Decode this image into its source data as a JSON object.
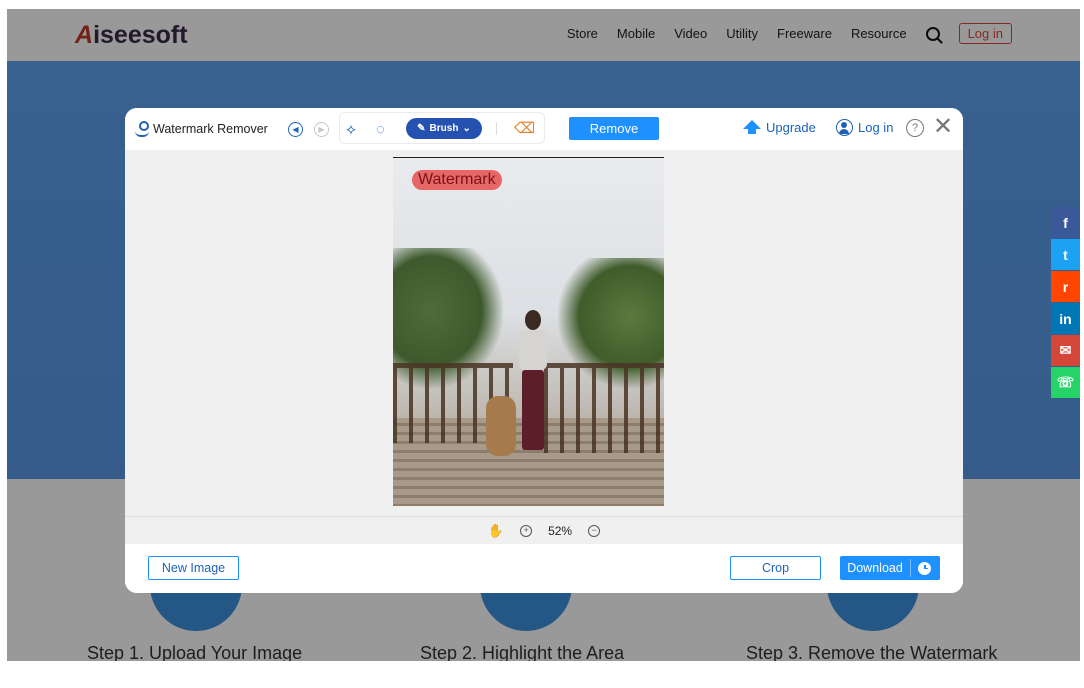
{
  "site": {
    "logo_mark": "A",
    "logo_text": "iseesoft",
    "nav": [
      "Store",
      "Mobile",
      "Video",
      "Utility",
      "Freeware",
      "Resource"
    ],
    "login_label": "Log in",
    "steps": [
      "Step 1. Upload Your Image",
      "Step 2. Highlight the Area",
      "Step 3. Remove the Watermark"
    ]
  },
  "social": [
    {
      "icon": "facebook-icon",
      "glyph": "f",
      "color": "#3b5998"
    },
    {
      "icon": "twitter-icon",
      "glyph": "t",
      "color": "#1da1f2"
    },
    {
      "icon": "reddit-icon",
      "glyph": "r",
      "color": "#ff4500"
    },
    {
      "icon": "linkedin-icon",
      "glyph": "in",
      "color": "#0077b5"
    },
    {
      "icon": "gmail-icon",
      "glyph": "✉",
      "color": "#d44638"
    },
    {
      "icon": "whatsapp-icon",
      "glyph": "☏",
      "color": "#25d366"
    }
  ],
  "modal": {
    "title": "Watermark Remover",
    "brush_label": "Brush",
    "remove_label": "Remove",
    "upgrade_label": "Upgrade",
    "login_label": "Log in",
    "help_glyph": "?",
    "close_glyph": "✕",
    "watermark_text": "Watermark",
    "zoom_level": "52%",
    "new_image_label": "New Image",
    "crop_label": "Crop",
    "download_label": "Download"
  },
  "colors": {
    "accent": "#1e90ff",
    "hero": "#5fa3f0",
    "brush": "#2552b0"
  }
}
